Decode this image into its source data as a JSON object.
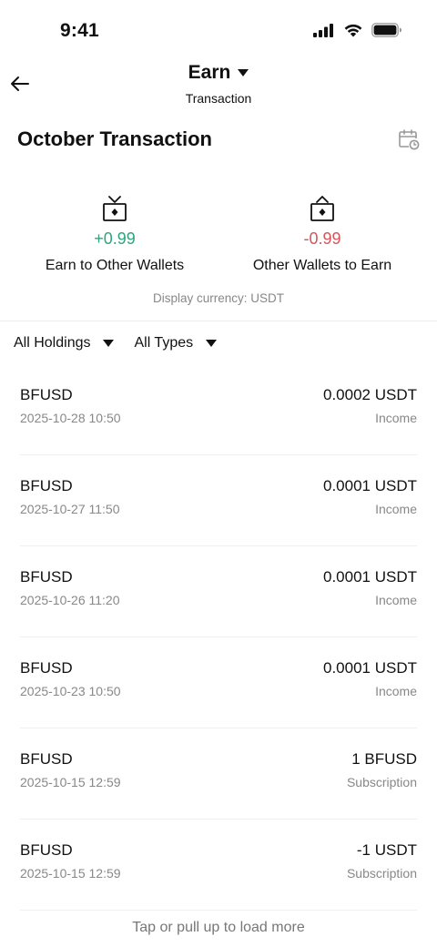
{
  "status_bar": {
    "time": "9:41"
  },
  "header": {
    "title": "Earn",
    "subtitle": "Transaction"
  },
  "month_title": "October Transaction",
  "summary": {
    "earn_to_other": {
      "value": "+0.99",
      "label": "Earn to Other Wallets",
      "color": "#2ea57c"
    },
    "other_to_earn": {
      "value": "-0.99",
      "label": "Other Wallets to Earn",
      "color": "#d2565a"
    },
    "currency_note": "Display currency: USDT"
  },
  "filters": {
    "holdings": "All Holdings",
    "types": "All Types"
  },
  "transactions": [
    {
      "asset": "BFUSD",
      "date": "2025-10-28 10:50",
      "amount": "0.0002 USDT",
      "type": "Income"
    },
    {
      "asset": "BFUSD",
      "date": "2025-10-27 11:50",
      "amount": "0.0001 USDT",
      "type": "Income"
    },
    {
      "asset": "BFUSD",
      "date": "2025-10-26 11:20",
      "amount": "0.0001 USDT",
      "type": "Income"
    },
    {
      "asset": "BFUSD",
      "date": "2025-10-23 10:50",
      "amount": "0.0001 USDT",
      "type": "Income"
    },
    {
      "asset": "BFUSD",
      "date": "2025-10-15 12:59",
      "amount": "1 BFUSD",
      "type": "Subscription"
    },
    {
      "asset": "BFUSD",
      "date": "2025-10-15 12:59",
      "amount": "-1 USDT",
      "type": "Subscription"
    }
  ],
  "load_more": "Tap or pull up to load more"
}
